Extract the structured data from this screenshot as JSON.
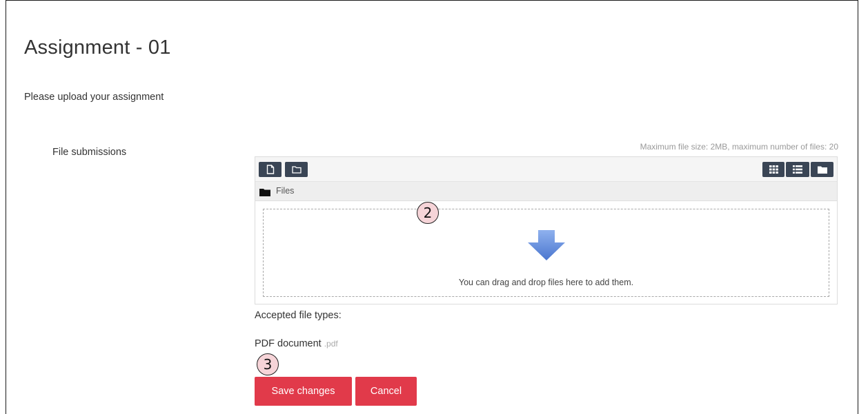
{
  "page": {
    "title": "Assignment - 01",
    "intro": "Please upload your assignment"
  },
  "submission": {
    "field_label": "File submissions",
    "limits": "Maximum file size: 2MB, maximum number of files: 20",
    "toolbar": {
      "left_buttons": [
        "add-file-icon",
        "create-folder-icon"
      ],
      "right_buttons": [
        "grid-view-icon",
        "list-view-icon",
        "tree-view-icon"
      ]
    },
    "path_label": "Files",
    "drop_text": "You can drag and drop files here to add them.",
    "accepted_label": "Accepted file types:",
    "file_type_name": "PDF document",
    "file_type_ext": ".pdf"
  },
  "markers": {
    "dropzone": "2",
    "save": "3"
  },
  "actions": {
    "save_label": "Save changes",
    "cancel_label": "Cancel"
  },
  "colors": {
    "primary_button": "#e13a4a",
    "toolbar_button": "#3a4555",
    "marker_fill": "#f6d4d8",
    "arrow": "#5b86d6"
  }
}
